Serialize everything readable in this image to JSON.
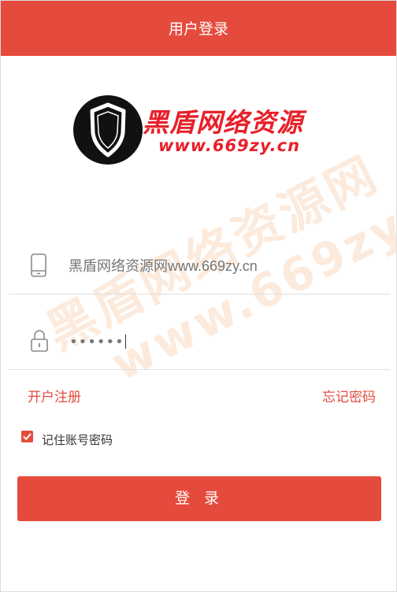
{
  "header": {
    "title": "用户登录"
  },
  "logo": {
    "title": "黑盾网络资源",
    "url": "www.669zy.cn"
  },
  "watermark": {
    "line1": "黑盾网络资源网",
    "line2": "www.669zy.cn"
  },
  "form": {
    "phone_placeholder": "黑盾网络资源网www.669zy.cn",
    "password_masked": "••••••"
  },
  "links": {
    "register": "开户注册",
    "forgot": "忘记密码"
  },
  "remember": {
    "label": "记住账号密码",
    "checked": true
  },
  "login_button": {
    "label": "登 录"
  },
  "colors": {
    "accent": "#e54b3d",
    "logo_red": "#e8202a"
  },
  "icons": {
    "phone": "phone-icon",
    "lock": "lock-icon",
    "shield": "shield-icon",
    "check": "check-icon"
  }
}
